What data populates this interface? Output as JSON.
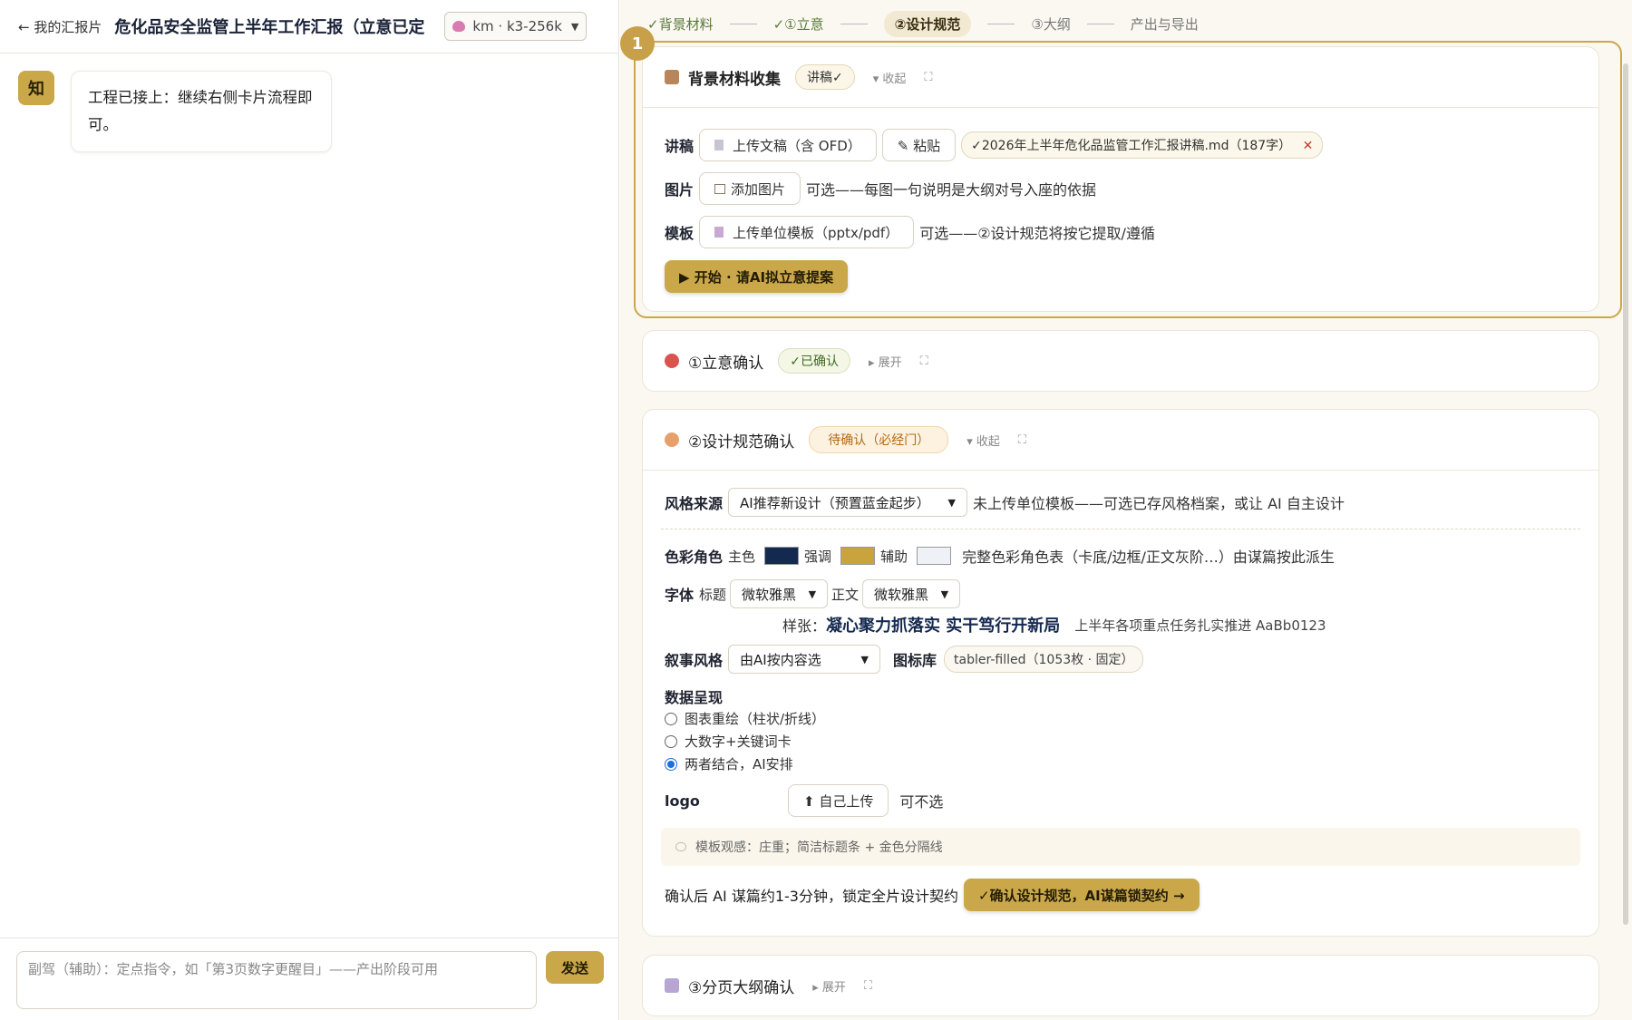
{
  "left": {
    "back_label": "← 我的汇报片",
    "doc_title": "危化品安全监管上半年工作汇报（立意已定",
    "model": "km · k3-256k",
    "chat_avatar": "知",
    "chat_message": "工程已接上：继续右侧卡片流程即可。",
    "input_placeholder": "副驾（辅助）：定点指令，如「第3页数字更醒目」——产出阶段可用",
    "send_label": "发送"
  },
  "stepper": {
    "steps": [
      {
        "label": "✓背景材料",
        "state": "done"
      },
      {
        "label": "✓①立意",
        "state": "done"
      },
      {
        "label": "②设计规范",
        "state": "active"
      },
      {
        "label": "③大纲",
        "state": "todo"
      },
      {
        "label": "产出与导出",
        "state": "todo"
      }
    ]
  },
  "marker_number": "1",
  "card_bg": {
    "title": "背景材料收集",
    "badge": "讲稿✓",
    "toggle": "▾ 收起",
    "rows": {
      "script_label": "讲稿",
      "upload_label": "上传文稿（含 OFD）",
      "paste_label": "✎ 粘贴",
      "file_chip": "✓2026年上半年危化品监管工作汇报讲稿.md（187字）",
      "image_label": "图片",
      "add_image_label": "添加图片",
      "image_hint": "可选——每图一句说明是大纲对号入座的依据",
      "template_label": "模板",
      "upload_template_label": "上传单位模板（pptx/pdf）",
      "template_hint": "可选——②设计规范将按它提取/遵循",
      "start_label": "▶ 开始 · 请AI拟立意提案"
    }
  },
  "card_intent": {
    "title": "①立意确认",
    "badge": "✓已确认",
    "toggle": "▸ 展开"
  },
  "card_design": {
    "title": "②设计规范确认",
    "badge": "待确认（必经门）",
    "toggle": "▾ 收起",
    "style_source_label": "风格来源",
    "style_source_value": "AI推荐新设计（预置蓝金起步）",
    "style_source_hint": "未上传单位模板——可选已存风格档案，或让 AI 自主设计",
    "color_label": "色彩角色",
    "color_primary_label": "主色",
    "color_accent_label": "强调",
    "color_aux_label": "辅助",
    "color_hint": "完整色彩角色表（卡底/边框/正文灰阶…）由谋篇按此派生",
    "colors": {
      "primary": "#14294f",
      "accent": "#c9a33b",
      "aux": "#eef2f6"
    },
    "font_label": "字体",
    "font_title_label": "标题",
    "font_title_value": "微软雅黑",
    "font_body_label": "正文",
    "font_body_value": "微软雅黑",
    "sample_label": "样张：",
    "sample_title": "凝心聚力抓落实 实干笃行开新局",
    "sample_body": "上半年各项重点任务扎实推进 AaBb0123",
    "narrative_label": "叙事风格",
    "narrative_value": "由AI按内容选",
    "iconlib_label": "图标库",
    "iconlib_value": "tabler-filled（1053枚 · 固定）",
    "data_label": "数据呈现",
    "data_options": [
      {
        "label": "图表重绘（柱状/折线）",
        "checked": false
      },
      {
        "label": "大数字+关键词卡",
        "checked": false
      },
      {
        "label": "两者结合，AI安排",
        "checked": true
      }
    ],
    "logo_label": "logo",
    "logo_upload": "⬆ 自己上传",
    "logo_hint": "可不选",
    "note": "模板观感：庄重；简洁标题条 + 金色分隔线",
    "confirm_hint": "确认后 AI 谋篇约1-3分钟，锁定全片设计契约",
    "confirm_button": "✓确认设计规范，AI谋篇锁契约 →"
  },
  "card_outline": {
    "title": "③分页大纲确认",
    "toggle": "▸ 展开"
  }
}
